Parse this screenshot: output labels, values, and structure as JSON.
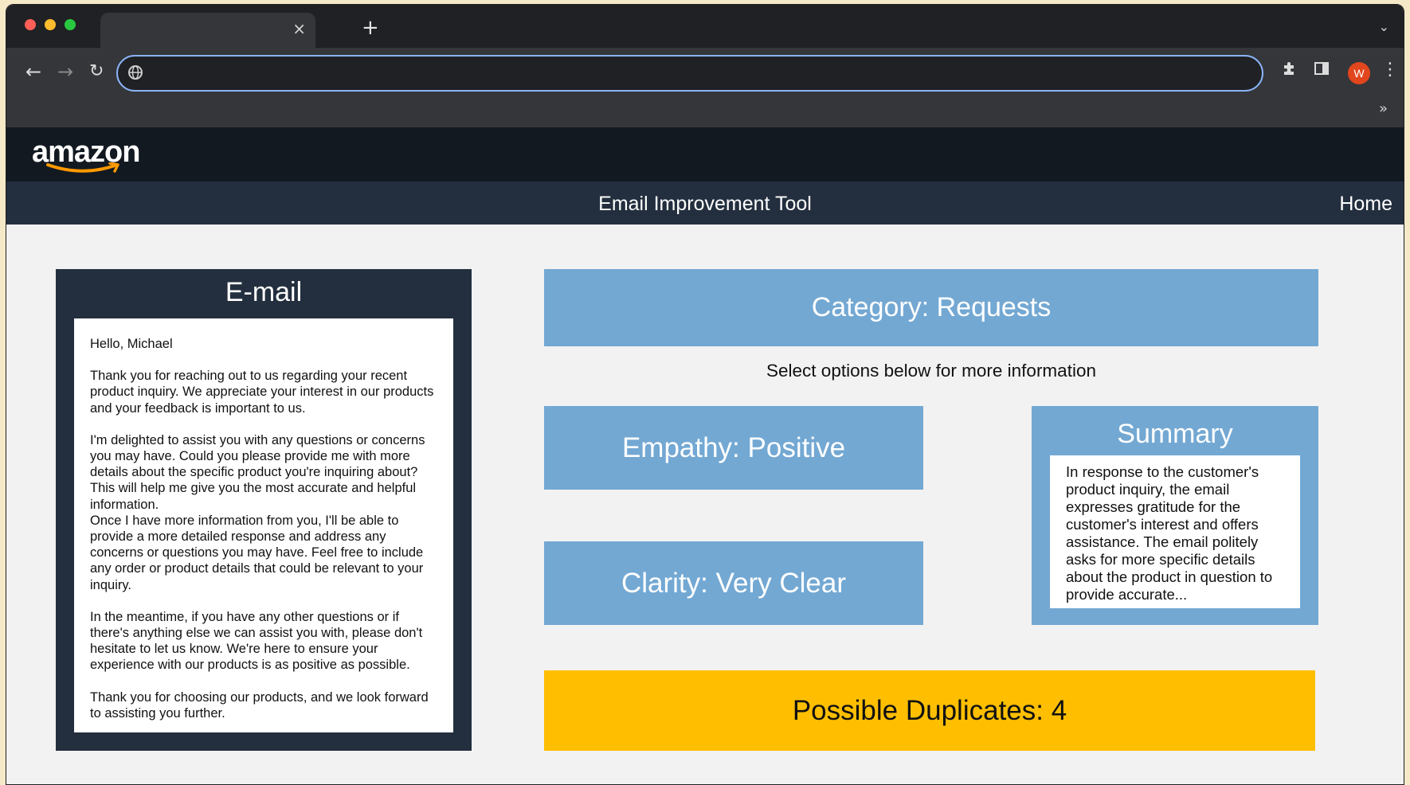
{
  "browser": {
    "tab_close": "×",
    "new_tab": "+",
    "tab_search": "⌄",
    "address": {
      "value": "",
      "placeholder": ""
    },
    "profile_initial": "W",
    "bookmarks_overflow": "»"
  },
  "site": {
    "logo_text": "amazon",
    "nav_title": "Email Improvement Tool",
    "nav_home": "Home"
  },
  "email": {
    "heading": "E-mail",
    "paragraphs": [
      "Hello, Michael",
      "Thank you for reaching out to us regarding your recent product inquiry. We appreciate your interest in our products and your feedback is important to us.",
      "I'm delighted to assist you with any questions or concerns you may have. Could you please provide me with more details about the specific product you're inquiring about? This will help me give you the most accurate and helpful information.",
      "Once I have more information from you, I'll be able to provide a more detailed response and address any concerns or questions you may have. Feel free to include any order or product details that could be relevant to your inquiry.",
      "In the meantime, if you have any other questions or if there's anything else we can assist you with, please don't hesitate to let us know. We're here to ensure your experience with our products is as positive as possible.",
      "Thank you for choosing our products, and we look forward to assisting you further."
    ]
  },
  "analysis": {
    "category": "Category: Requests",
    "instructions": "Select options below for more information",
    "empathy": "Empathy: Positive",
    "clarity": "Clarity: Very Clear",
    "summary_heading": "Summary",
    "summary_text": "In response to the customer's product inquiry, the email expresses gratitude for the customer's interest and offers assistance. The email politely asks for more specific details about the product in question to provide accurate...",
    "duplicates": "Possible Duplicates: 4"
  },
  "colors": {
    "card_blue": "#73a8d3",
    "duplicates_yellow": "#ffbf00",
    "nav_dark": "#232f3e",
    "brand_dark": "#131921",
    "logo_smile": "#ff9900"
  },
  "icons": {
    "back": "arrow-left-icon",
    "forward": "arrow-right-icon",
    "reload": "reload-icon",
    "site_info": "globe-icon",
    "extensions": "puzzle-icon",
    "side_panel": "side-panel-icon",
    "menu": "kebab-menu-icon"
  }
}
